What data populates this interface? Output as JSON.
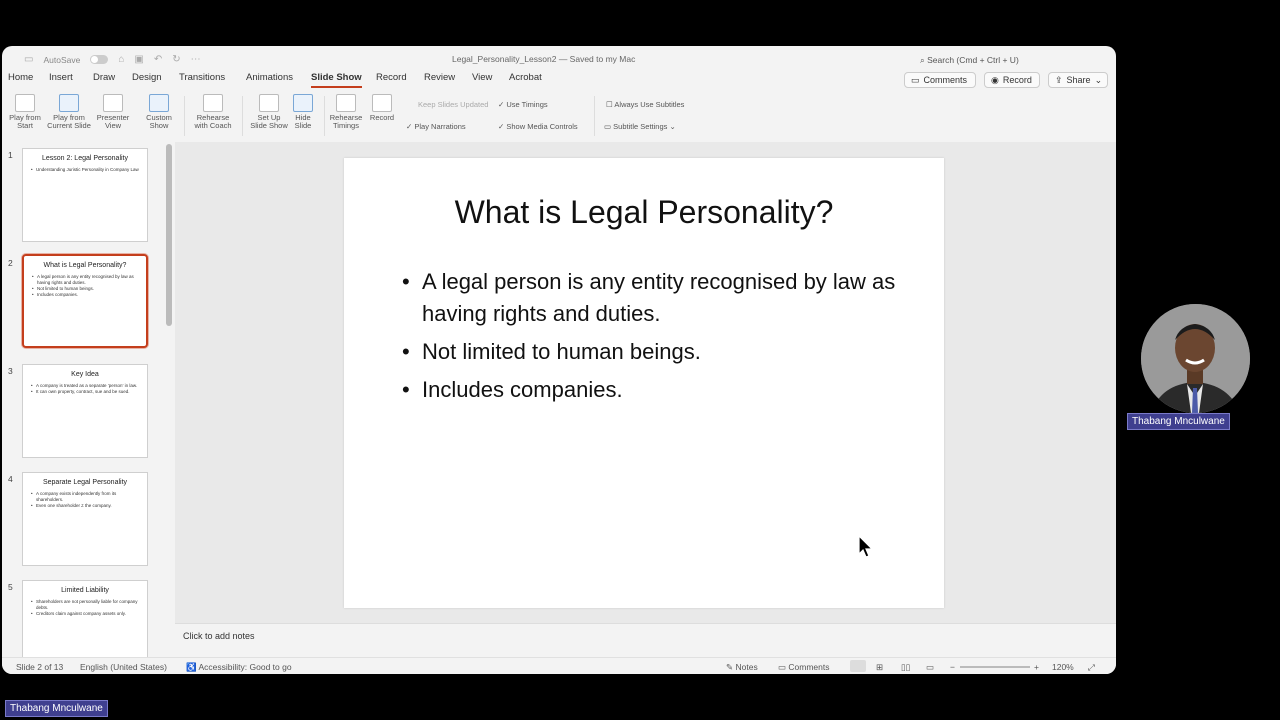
{
  "titlebar": {
    "autosave_label": "AutoSave",
    "document_title": "Legal_Personality_Lesson2",
    "save_status": "— Saved to my Mac",
    "search_placeholder": "Search (Cmd + Ctrl + U)"
  },
  "menu": {
    "tabs": [
      "Home",
      "Insert",
      "Draw",
      "Design",
      "Transitions",
      "Animations",
      "Slide Show",
      "Record",
      "Review",
      "View",
      "Acrobat"
    ],
    "active_tab": "Slide Show",
    "comments_label": "Comments",
    "record_label": "Record",
    "share_label": "Share"
  },
  "ribbon": {
    "play_from_start": [
      "Play from",
      "Start"
    ],
    "play_from_current": [
      "Play from",
      "Current Slide"
    ],
    "presenter_view": [
      "Presenter",
      "View"
    ],
    "custom_show": [
      "Custom",
      "Show"
    ],
    "rehearse_coach": [
      "Rehearse",
      "with Coach"
    ],
    "set_up": [
      "Set Up",
      "Slide Show"
    ],
    "hide_slide": [
      "Hide",
      "Slide"
    ],
    "rehearse_timings": [
      "Rehearse",
      "Timings"
    ],
    "record": "Record",
    "keep_slides_updated": "Keep Slides Updated",
    "use_timings": "Use Timings",
    "play_narrations": "Play Narrations",
    "show_media_controls": "Show Media Controls",
    "always_use_subtitles": "Always Use Subtitles",
    "subtitle_settings": "Subtitle Settings"
  },
  "thumbnails": [
    {
      "num": "1",
      "title": "Lesson 2: Legal Personality",
      "bullets": [
        "Understanding Juristic Personality in Company Law"
      ]
    },
    {
      "num": "2",
      "title": "What is Legal Personality?",
      "bullets": [
        "A legal person is any entity recognised by law as having rights and duties.",
        "Not limited to human beings.",
        "Includes companies."
      ]
    },
    {
      "num": "3",
      "title": "Key Idea",
      "bullets": [
        "A company is treated as a separate ‘person’ in law.",
        "It can own property, contract, sue and be sued."
      ]
    },
    {
      "num": "4",
      "title": "Separate Legal Personality",
      "bullets": [
        "A company exists independently from its shareholders.",
        "Even one shareholder ≠ the company."
      ]
    },
    {
      "num": "5",
      "title": "Limited Liability",
      "bullets": [
        "Shareholders are not personally liable for company debts.",
        "Creditors claim against company assets only."
      ]
    }
  ],
  "slide": {
    "title": "What is Legal Personality?",
    "bullets": [
      "A legal person is any entity recognised by law as having rights and duties.",
      "Not limited to human beings.",
      "Includes companies."
    ]
  },
  "notes_placeholder": "Click to add notes",
  "status": {
    "slide_counter": "Slide 2 of 13",
    "language": "English (United States)",
    "accessibility": "Accessibility: Good to go",
    "notes_label": "Notes",
    "comments_label": "Comments",
    "zoom": "120%"
  },
  "participant": {
    "name": "Thabang Mnculwane"
  },
  "colors": {
    "accent": "#c43e1c",
    "name_tag": "#3f3f8f"
  }
}
